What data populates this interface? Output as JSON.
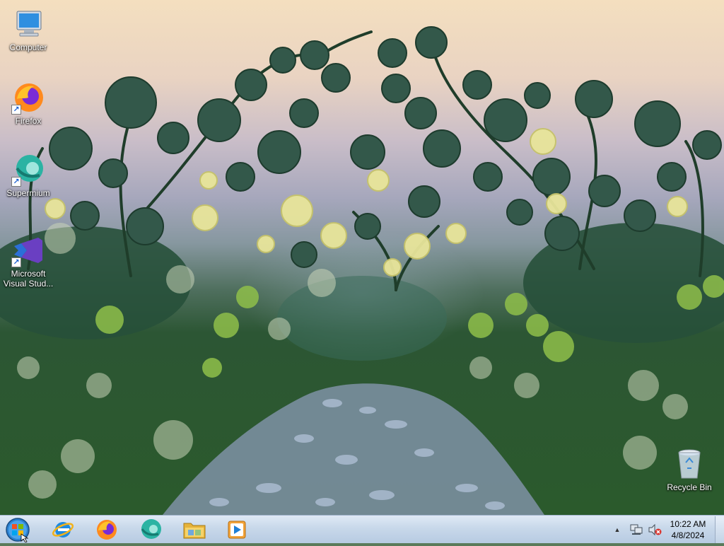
{
  "desktop": {
    "icons": [
      {
        "label": "Computer",
        "icon": "computer-icon"
      },
      {
        "label": "Firefox",
        "icon": "firefox-icon"
      },
      {
        "label": "Supermium",
        "icon": "supermium-icon"
      },
      {
        "label": "Microsoft Visual Stud...",
        "icon": "visual-studio-icon"
      },
      {
        "label": "Recycle Bin",
        "icon": "recycle-bin-icon"
      }
    ],
    "wallpaper": "garden-path"
  },
  "taskbar": {
    "start": {
      "icon": "windows-start-orb"
    },
    "pinned": [
      {
        "name": "Internet Explorer",
        "icon": "internet-explorer-icon"
      },
      {
        "name": "Firefox",
        "icon": "firefox-icon"
      },
      {
        "name": "Supermium",
        "icon": "supermium-icon"
      },
      {
        "name": "File Explorer",
        "icon": "folder-icon"
      },
      {
        "name": "Windows Media Player",
        "icon": "media-player-icon"
      }
    ],
    "tray": {
      "icons": [
        "show-hidden-icons-chevron",
        "network-icon",
        "volume-muted-icon"
      ],
      "chevron": "▲"
    },
    "clock": {
      "time": "10:22 AM",
      "date": "4/8/2024"
    }
  },
  "colors": {
    "taskbar": "#c8d8ea",
    "sky_top": "#f4dfbf",
    "foliage": "#2b5a2c"
  }
}
